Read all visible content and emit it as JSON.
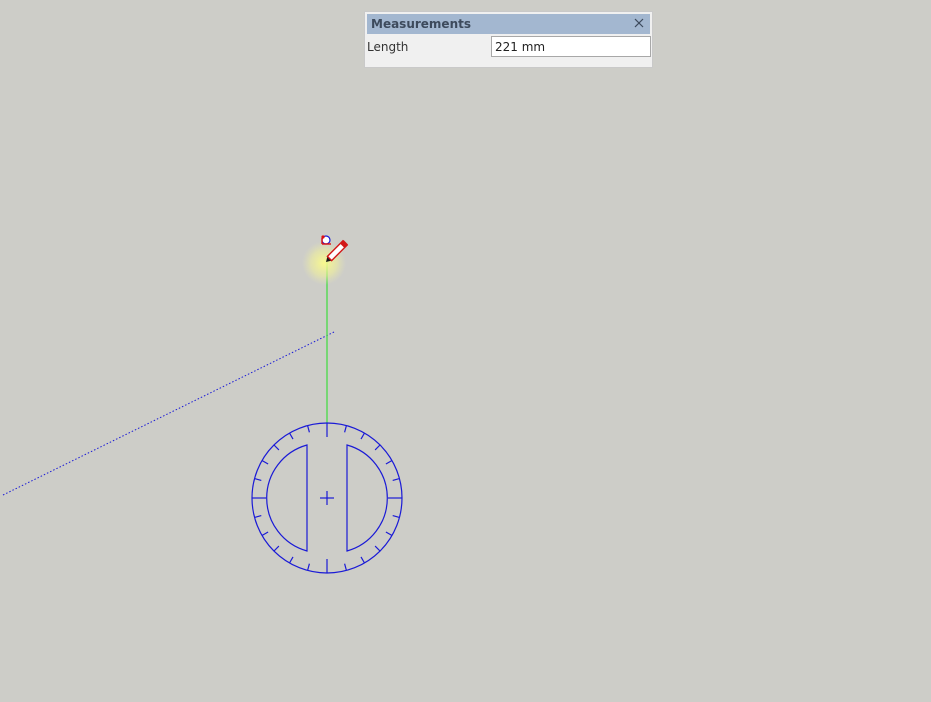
{
  "measurements": {
    "title": "Measurements",
    "length_label": "Length",
    "length_value": "221 mm",
    "close_icon": "close-icon"
  },
  "scene": {
    "background_color": "#cdcdc8",
    "axis_color": "#1a1ad6",
    "drawing_line_color": "#3ddc3d",
    "protractor_color": "#1a1ad6",
    "cursor_icon": "pencil-icon",
    "snap_indicator": "endpoint-snap-icon"
  }
}
